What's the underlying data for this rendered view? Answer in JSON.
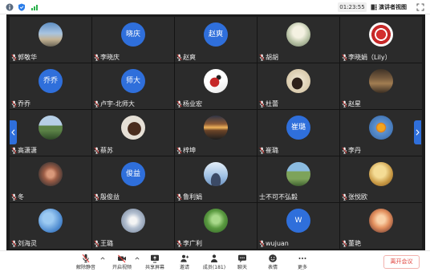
{
  "topbar": {
    "timer": "01:23:55",
    "view_button": {
      "label": "演讲者视图",
      "icon": "speaker-view-icon"
    },
    "icons": {
      "info": "meeting-info-icon",
      "security": "shield-icon",
      "network": "signal-icon",
      "fullscreen": "fullscreen-icon"
    }
  },
  "gallery_nav": {
    "prev_icon": "chevron-left-icon",
    "next_icon": "chevron-right-icon"
  },
  "participants": [
    {
      "name": "郭敬华",
      "muted": true
    },
    {
      "name": "李晓庆",
      "avatar_text": "晓庆",
      "muted": true
    },
    {
      "name": "赵爽",
      "avatar_text": "赵爽",
      "muted": true
    },
    {
      "name": "胡胡",
      "muted": true
    },
    {
      "name": "李晓娟（Lily）",
      "muted": true
    },
    {
      "name": "乔乔",
      "avatar_text": "乔乔",
      "muted": true
    },
    {
      "name": "卢宇-北师大",
      "avatar_text": "师大",
      "muted": true
    },
    {
      "name": "杨业宏",
      "muted": true
    },
    {
      "name": "杜蕾",
      "muted": true
    },
    {
      "name": "赵星",
      "muted": true
    },
    {
      "name": "高潇潇",
      "muted": true
    },
    {
      "name": "蔡苏",
      "muted": true
    },
    {
      "name": "梓坤",
      "muted": true
    },
    {
      "name": "崔璐",
      "avatar_text": "崔璐",
      "muted": true
    },
    {
      "name": "李丹",
      "muted": true
    },
    {
      "name": "冬",
      "muted": true
    },
    {
      "name": "殷俊益",
      "avatar_text": "俊益",
      "muted": true
    },
    {
      "name": "鲁利娟",
      "muted": true
    },
    {
      "name": "士不可不弘毅",
      "muted": false
    },
    {
      "name": "张悦欧",
      "muted": true
    },
    {
      "name": "刘海灵",
      "muted": true
    },
    {
      "name": "王璐",
      "muted": true
    },
    {
      "name": "李广利",
      "muted": true
    },
    {
      "name": "wujuan",
      "avatar_text": "W",
      "muted": true
    },
    {
      "name": "董艳",
      "muted": true
    }
  ],
  "toolbar": {
    "unmute": {
      "label": "解除静音",
      "icon": "mic-muted-icon"
    },
    "video": {
      "label": "开启视频",
      "icon": "camera-off-icon"
    },
    "share": {
      "label": "共享屏幕",
      "icon": "share-screen-icon"
    },
    "invite": {
      "label": "邀请",
      "icon": "invite-user-icon"
    },
    "members": {
      "label": "成员(181)",
      "icon": "members-icon"
    },
    "chat": {
      "label": "聊天",
      "icon": "chat-icon"
    },
    "reactions": {
      "label": "表情",
      "icon": "smiley-icon"
    },
    "more": {
      "label": "更多",
      "icon": "more-dots-icon"
    },
    "leave": {
      "label": "离开会议"
    }
  },
  "colors": {
    "accent": "#2f6fdb",
    "danger": "#e0443e",
    "mute": "#e53935",
    "stage": "#1b1b1b",
    "tile": "#2b2b2b"
  }
}
